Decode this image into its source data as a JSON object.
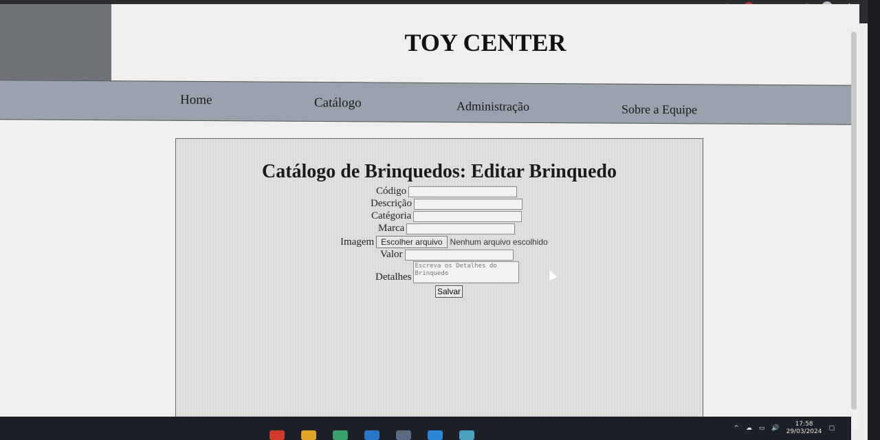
{
  "header": {
    "title": "TOY CENTER"
  },
  "nav": {
    "items": [
      "Home",
      "Catálogo",
      "Administração",
      "Sobre a Equipe"
    ]
  },
  "form": {
    "title": "Catálogo de Brinquedos: Editar Brinquedo",
    "fields": {
      "codigo_label": "Código",
      "descricao_label": "Descrição",
      "categoria_label": "Catégoria",
      "marca_label": "Marca",
      "imagem_label": "Imagem",
      "imagem_button": "Escolher arquivo",
      "imagem_status": "Nenhum arquivo escolhido",
      "valor_label": "Valor",
      "detalhes_label": "Detalhes",
      "detalhes_placeholder": "Escreva os Detalhes do Brinquedo"
    },
    "save_label": "Salvar"
  },
  "taskbar": {
    "time": "17:58",
    "date": "29/03/2024"
  },
  "colors": {
    "navbar": "#9aa2ae",
    "page_bg": "#eff0ed",
    "taskbar": "#1e2027"
  }
}
